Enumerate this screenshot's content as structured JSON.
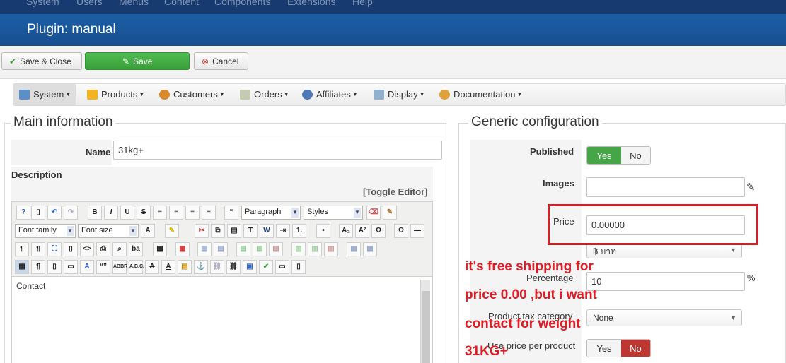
{
  "top_menu": [
    "System",
    "Users",
    "Menus",
    "Content",
    "Components",
    "Extensions",
    "Help"
  ],
  "header": {
    "title": "Plugin: manual"
  },
  "toolbar": {
    "save_close": "Save & Close",
    "save": "Save",
    "cancel": "Cancel"
  },
  "nav_menu": [
    {
      "label": "System",
      "icon": "wrench-icon"
    },
    {
      "label": "Products",
      "icon": "products-icon"
    },
    {
      "label": "Customers",
      "icon": "customers-icon"
    },
    {
      "label": "Orders",
      "icon": "orders-icon"
    },
    {
      "label": "Affiliates",
      "icon": "affiliates-icon"
    },
    {
      "label": "Display",
      "icon": "display-icon"
    },
    {
      "label": "Documentation",
      "icon": "documentation-icon"
    }
  ],
  "main_info": {
    "legend": "Main information",
    "name_label": "Name",
    "name_value": "31kg+",
    "description_label": "Description",
    "toggle_editor": "[Toggle Editor]",
    "editor": {
      "format_select": "Paragraph",
      "styles_select": "Styles",
      "font_family": "Font family",
      "font_size": "Font size",
      "content": "Contact"
    }
  },
  "generic_config": {
    "legend": "Generic configuration",
    "published_label": "Published",
    "published_yes": "Yes",
    "published_no": "No",
    "images_label": "Images",
    "price_label": "Price",
    "price_value": "0.00000",
    "currency_value": "฿ บาท",
    "percentage_label": "Percentage",
    "percentage_value": "10",
    "percentage_unit": "%",
    "tax_label": "Product tax category",
    "tax_value": "None",
    "use_price_label": "Use price per product",
    "use_price_yes": "Yes",
    "use_price_no": "No"
  },
  "annotation": {
    "line1": "it's free shipping for",
    "line2": "price 0.00 ,but i want",
    "line3": "contact for weight",
    "line4": "31KG+"
  },
  "colors": {
    "header_blue": "#1d5ea4",
    "save_green": "#3a9e3a",
    "active_green": "#46a546",
    "no_red": "#bd362f",
    "annotation_red": "#e11a23"
  }
}
